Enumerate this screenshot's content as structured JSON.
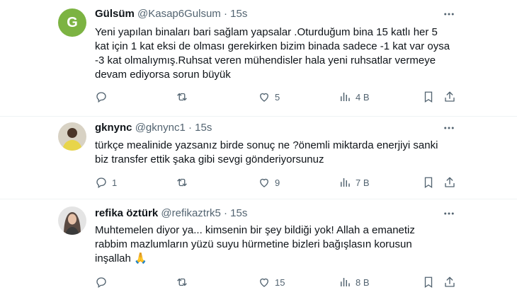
{
  "tweets": [
    {
      "avatar_letter": "G",
      "name": "Gülsüm",
      "handle": "@Kasap6Gulsum",
      "dot": "·",
      "time": "15s",
      "lines": [
        "Yeni yapılan binaları bari sağlam yapsalar .Oturduğum bina 15 katlı her  5",
        "kat için 1 kat eksi de olması gerekirken bizim binada sadece -1 kat var oysa",
        "-3 kat olmalıymış.Ruhsat veren mühendisler hala yeni ruhsatlar vermeye",
        "devam ediyorsa sorun büyük"
      ],
      "replies": "",
      "retweets": "",
      "likes": "5",
      "views": "4 B"
    },
    {
      "name": "gknync",
      "handle": "@gknync1",
      "dot": "·",
      "time": "15s",
      "lines": [
        "türkçe mealinide yazsanız birde sonuç ne ?önemli miktarda enerjiyi sanki",
        "biz transfer ettik şaka gibi sevgi gönderiyorsunuz"
      ],
      "replies": "1",
      "retweets": "",
      "likes": "9",
      "views": "7 B"
    },
    {
      "name": "refika öztürk",
      "handle": "@refikaztrk5",
      "dot": "·",
      "time": "15s",
      "lines": [
        "Muhtemelen diyor ya... kimsenin bir şey bildiği yok! Allah a emanetiz",
        "rabbim mazlumların yüzü suyu hürmetine bizleri bağışlasın korusun",
        "inşallah 🙏"
      ],
      "replies": "",
      "retweets": "",
      "likes": "15",
      "views": "8 B"
    }
  ],
  "icons": {
    "reply": "reply-icon",
    "retweet": "retweet-icon",
    "like": "heart-icon",
    "views": "views-icon",
    "bookmark": "bookmark-icon",
    "share": "share-icon",
    "more": "more-icon"
  },
  "colors": {
    "icon_gray": "#536471",
    "avatar_green": "#7cb342",
    "divider": "#eff3f4"
  }
}
